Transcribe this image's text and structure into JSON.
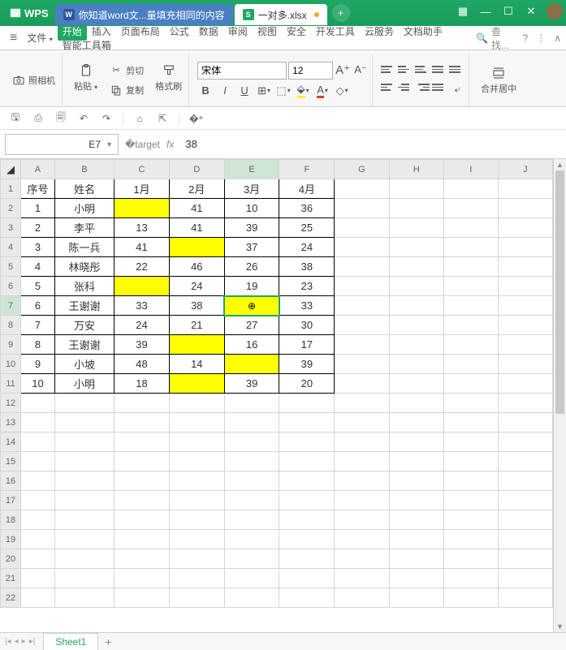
{
  "app": {
    "name": "WPS"
  },
  "tabs": {
    "word": {
      "label": "你知道word文...量填充相同的内容",
      "icon": "W"
    },
    "active": {
      "label": "一对多.xlsx",
      "icon": "S"
    }
  },
  "menu": {
    "file": "文件",
    "items": [
      "开始",
      "插入",
      "页面布局",
      "公式",
      "数据",
      "审阅",
      "视图",
      "安全",
      "开发工具",
      "云服务",
      "文档助手",
      "智能工具箱"
    ],
    "active_index": 0,
    "search": "查找..."
  },
  "ribbon": {
    "camera": "照相机",
    "paste": "粘贴",
    "cut": "剪切",
    "copy": "复制",
    "format_painter": "格式刷",
    "font_name": "宋体",
    "font_size": "12",
    "merge": "合并居中"
  },
  "namebox": "E7",
  "formula": "38",
  "columns": [
    "A",
    "B",
    "C",
    "D",
    "E",
    "F",
    "G",
    "H",
    "I",
    "J"
  ],
  "selected_col": "E",
  "selected_row": 7,
  "row_count": 22,
  "data": {
    "headers": [
      "序号",
      "姓名",
      "1月",
      "2月",
      "3月",
      "4月"
    ],
    "rows": [
      {
        "n": "1",
        "name": "小明",
        "c": "",
        "d": "41",
        "e": "10",
        "f": "36",
        "y": [
          "c"
        ]
      },
      {
        "n": "2",
        "name": "李平",
        "c": "13",
        "d": "41",
        "e": "39",
        "f": "25",
        "y": []
      },
      {
        "n": "3",
        "name": "陈一兵",
        "c": "41",
        "d": "",
        "e": "37",
        "f": "24",
        "y": [
          "d"
        ]
      },
      {
        "n": "4",
        "name": "林晓彤",
        "c": "22",
        "d": "46",
        "e": "26",
        "f": "38",
        "y": []
      },
      {
        "n": "5",
        "name": "张科",
        "c": "",
        "d": "24",
        "e": "19",
        "f": "23",
        "y": [
          "c"
        ]
      },
      {
        "n": "6",
        "name": "王谢谢",
        "c": "33",
        "d": "38",
        "e": "",
        "f": "33",
        "y": [
          "e"
        ]
      },
      {
        "n": "7",
        "name": "万安",
        "c": "24",
        "d": "21",
        "e": "27",
        "f": "30",
        "y": []
      },
      {
        "n": "8",
        "name": "王谢谢",
        "c": "39",
        "d": "",
        "e": "16",
        "f": "17",
        "y": [
          "d"
        ]
      },
      {
        "n": "9",
        "name": "小坡",
        "c": "48",
        "d": "14",
        "e": "",
        "f": "39",
        "y": [
          "e"
        ]
      },
      {
        "n": "10",
        "name": "小明",
        "c": "18",
        "d": "",
        "e": "39",
        "f": "20",
        "y": [
          "d"
        ]
      }
    ]
  },
  "sheet": {
    "name": "Sheet1"
  }
}
